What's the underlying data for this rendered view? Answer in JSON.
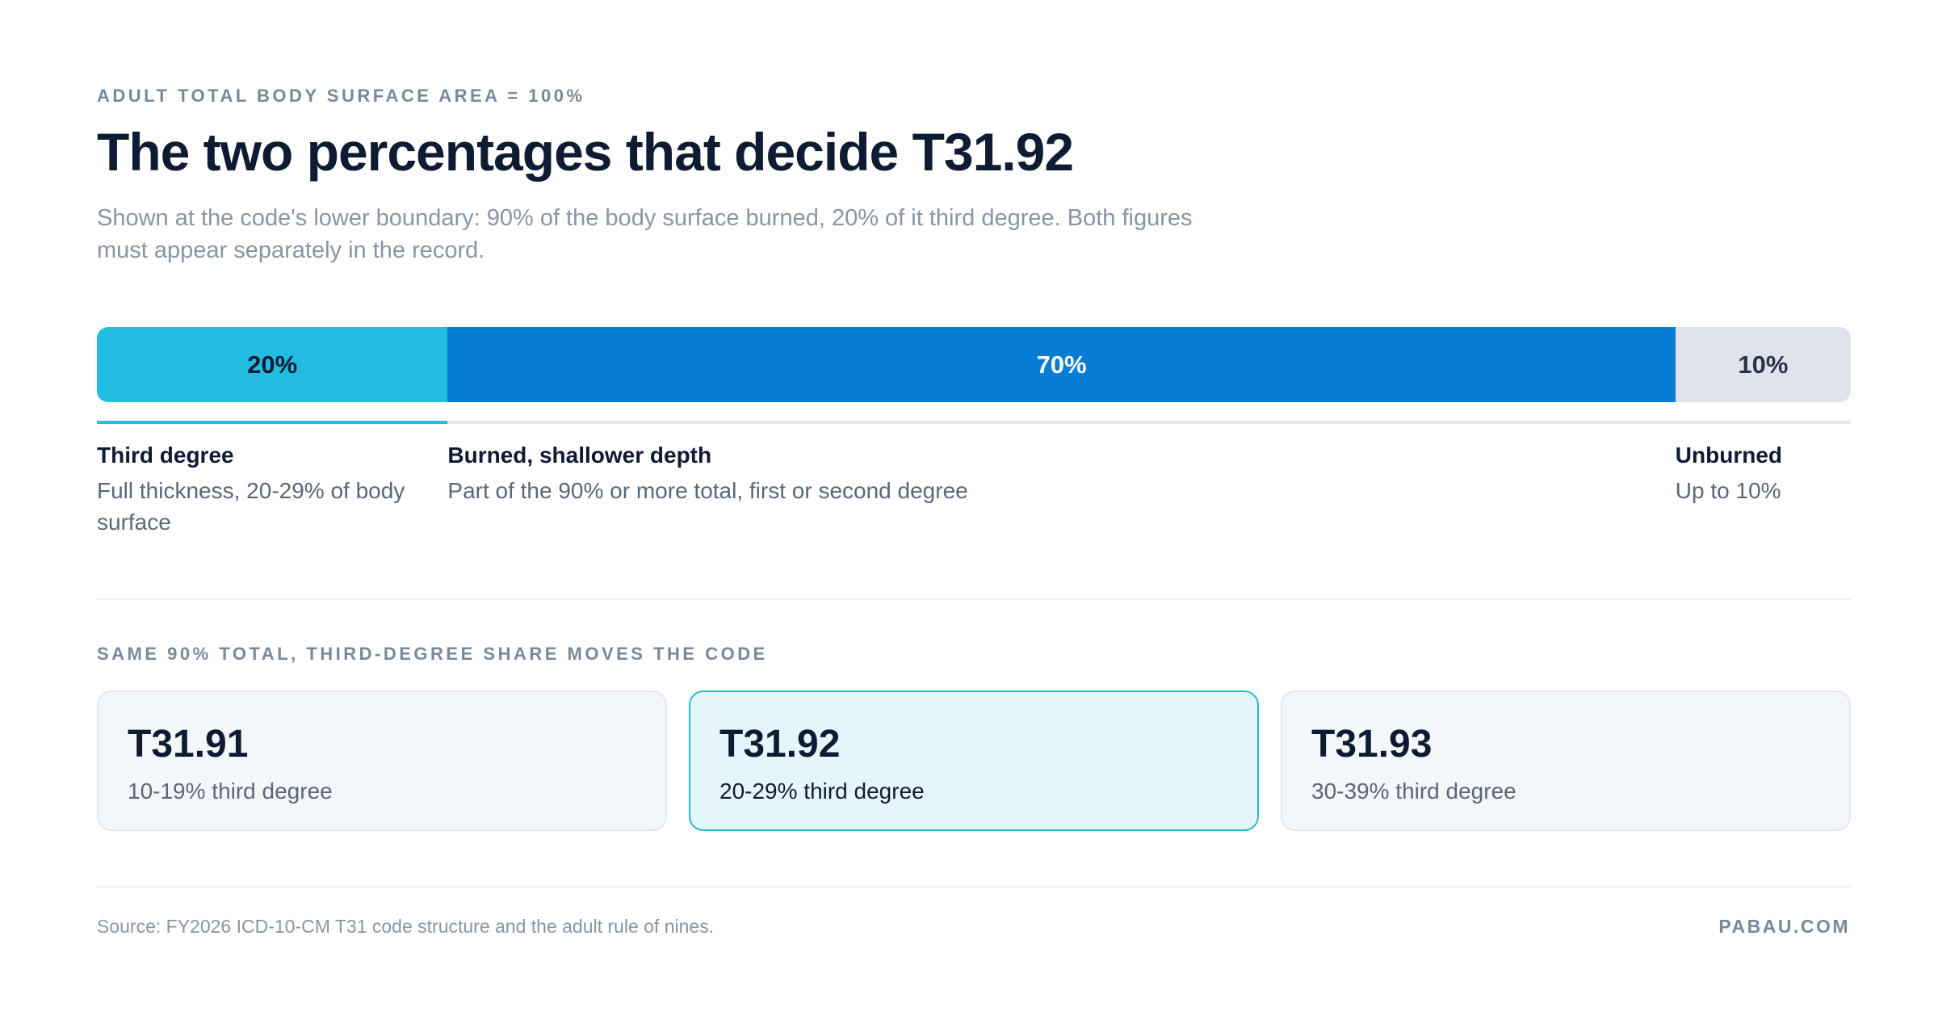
{
  "header": {
    "eyebrow": "ADULT TOTAL BODY SURFACE AREA = 100%",
    "title": "The two percentages that decide T31.92",
    "subtitle": "Shown at the code's lower boundary: 90% of the body surface burned, 20% of it third degree. Both figures must appear separately in the record."
  },
  "chart_data": {
    "type": "bar",
    "title": "",
    "categories": [
      "Third degree",
      "Burned, shallower depth",
      "Unburned"
    ],
    "values": [
      20,
      70,
      10
    ],
    "value_labels": [
      "20%",
      "70%",
      "10%"
    ],
    "descriptions": [
      "Full thickness, 20-29% of body surface",
      "Part of the 90% or more total, first or second degree",
      "Up to 10%"
    ],
    "colors": [
      "#23bde2",
      "#077cd4",
      "#dfe3ec"
    ],
    "label_colors": [
      "#0f1b33",
      "#ffffff",
      "#2a3448"
    ],
    "total": 100,
    "stacked": true,
    "orientation": "horizontal"
  },
  "comparison": {
    "heading": "SAME 90% TOTAL, THIRD-DEGREE SHARE MOVES THE CODE",
    "cards": [
      {
        "code": "T31.91",
        "range": "10-19% third degree",
        "highlighted": false
      },
      {
        "code": "T31.92",
        "range": "20-29% third degree",
        "highlighted": true
      },
      {
        "code": "T31.93",
        "range": "30-39% third degree",
        "highlighted": false
      }
    ]
  },
  "footer": {
    "source": "Source: FY2026 ICD-10-CM T31 code structure and the adult rule of nines.",
    "brand": "PABAU.COM"
  }
}
